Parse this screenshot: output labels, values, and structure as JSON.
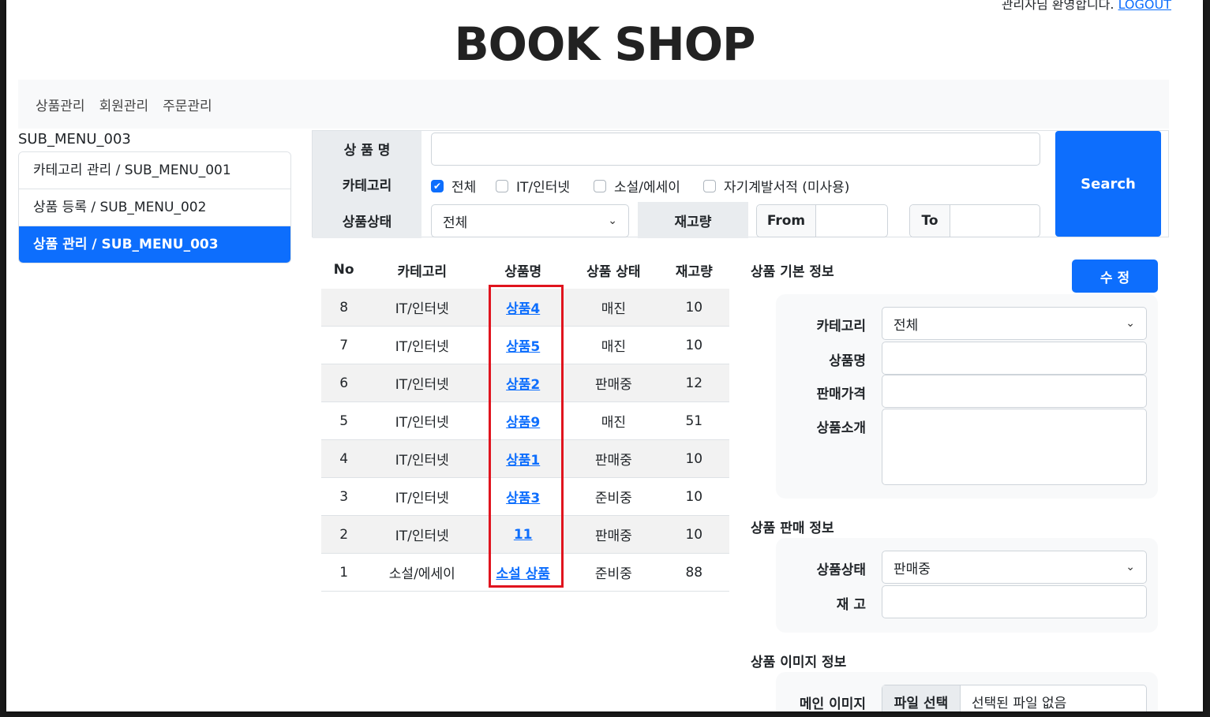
{
  "header": {
    "top_note": "관리자님 환영합니다.",
    "logout_label": "LOGOUT",
    "logo": "BOOK SHOP"
  },
  "nav": {
    "items": [
      "상품관리",
      "회원관리",
      "주문관리"
    ]
  },
  "sidebar": {
    "title": "SUB_MENU_003",
    "items": [
      {
        "label": "카테고리 관리 / SUB_MENU_001"
      },
      {
        "label": "상품 등록 / SUB_MENU_002"
      },
      {
        "label": "상품 관리 / SUB_MENU_003"
      }
    ]
  },
  "search": {
    "name_label": "상 품 명",
    "name_value": "",
    "category_label": "카테고리",
    "categories": [
      {
        "label": "전체",
        "checked": true
      },
      {
        "label": "IT/인터넷",
        "checked": false
      },
      {
        "label": "소설/에세이",
        "checked": false
      },
      {
        "label": "자기계발서적 (미사용)",
        "checked": false
      }
    ],
    "status_label": "상품상태",
    "status_value": "전체",
    "stock_label": "재고량",
    "from_label": "From",
    "to_label": "To",
    "button": "Search"
  },
  "table": {
    "headers": [
      "No",
      "카테고리",
      "상품명",
      "상품 상태",
      "재고량"
    ],
    "rows": [
      {
        "no": "8",
        "category": "IT/인터넷",
        "name": "상품4",
        "status": "매진",
        "stock": "10"
      },
      {
        "no": "7",
        "category": "IT/인터넷",
        "name": "상품5",
        "status": "매진",
        "stock": "10"
      },
      {
        "no": "6",
        "category": "IT/인터넷",
        "name": "상품2",
        "status": "판매중",
        "stock": "12"
      },
      {
        "no": "5",
        "category": "IT/인터넷",
        "name": "상품9",
        "status": "매진",
        "stock": "51"
      },
      {
        "no": "4",
        "category": "IT/인터넷",
        "name": "상품1",
        "status": "판매중",
        "stock": "10"
      },
      {
        "no": "3",
        "category": "IT/인터넷",
        "name": "상품3",
        "status": "준비중",
        "stock": "10"
      },
      {
        "no": "2",
        "category": "IT/인터넷",
        "name": "11",
        "status": "판매중",
        "stock": "10"
      },
      {
        "no": "1",
        "category": "소설/에세이",
        "name": "소설 상품",
        "status": "준비중",
        "stock": "88"
      }
    ]
  },
  "detail": {
    "basic_title": "상품 기본 정보",
    "edit_button": "수 정",
    "category_label": "카테고리",
    "category_value": "전체",
    "name_label": "상품명",
    "price_label": "판매가격",
    "intro_label": "상품소개",
    "sale_title": "상품 판매 정보",
    "status_label": "상품상태",
    "status_value": "판매중",
    "stock_label": "재 고",
    "image_title": "상품 이미지 정보",
    "main_image_label": "메인 이미지",
    "file_button": "파일 선택",
    "file_status": "선택된 파일 없음"
  }
}
